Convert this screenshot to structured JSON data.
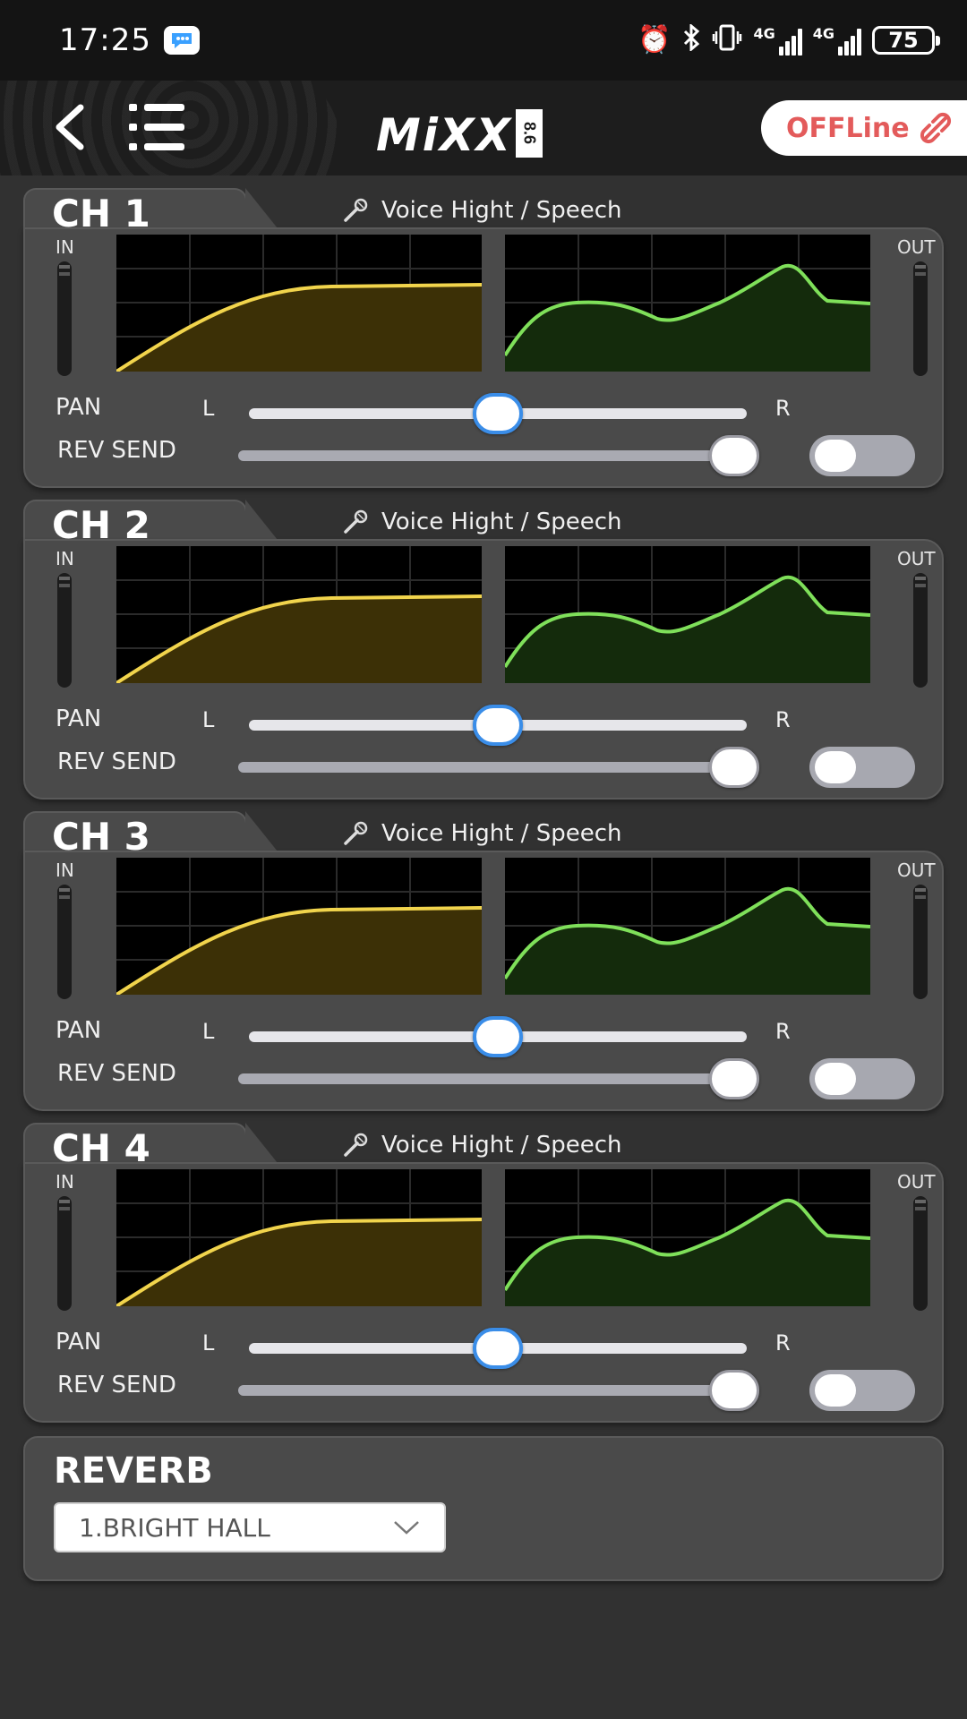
{
  "status_bar": {
    "time": "17:25",
    "battery": "75",
    "net_label_1": "4G",
    "net_label_2": "4G",
    "icons": [
      "chat-icon",
      "alarm-icon",
      "bluetooth-icon",
      "vibrate-icon",
      "signal-icon",
      "signal-icon",
      "battery-icon"
    ]
  },
  "header": {
    "logo_text": "MiXX",
    "logo_badge": "8.6",
    "connection_label": "OFFLine",
    "icons": [
      "back-icon",
      "menu-icon",
      "link-off-icon"
    ]
  },
  "colors": {
    "background": "#313131",
    "card": "#4a4a4a",
    "input_curve": "#f1d44c",
    "eq_curve": "#7fe05a",
    "accent_blue": "#3a8de8",
    "offline_red": "#e35b5b"
  },
  "labels": {
    "in": "IN",
    "out": "OUT",
    "pan": "PAN",
    "left": "L",
    "right": "R",
    "rev_send": "REV SEND"
  },
  "channels": [
    {
      "name": "CH 1",
      "preset": "Voice Hight / Speech",
      "pan": 0.5,
      "rev_send": 1.0,
      "reverb_enabled": false
    },
    {
      "name": "CH 2",
      "preset": "Voice Hight / Speech",
      "pan": 0.5,
      "rev_send": 1.0,
      "reverb_enabled": false
    },
    {
      "name": "CH 3",
      "preset": "Voice Hight / Speech",
      "pan": 0.5,
      "rev_send": 1.0,
      "reverb_enabled": false
    },
    {
      "name": "CH 4",
      "preset": "Voice Hight / Speech",
      "pan": 0.5,
      "rev_send": 1.0,
      "reverb_enabled": false
    }
  ],
  "reverb": {
    "title": "REVERB",
    "selected": "1.BRIGHT HALL"
  }
}
